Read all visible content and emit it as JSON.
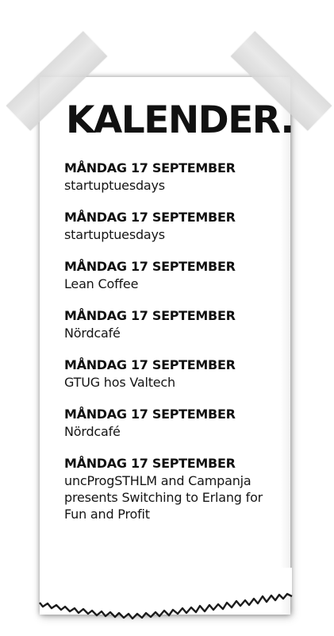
{
  "calendar": {
    "title": "KALENDER.",
    "events": [
      {
        "date": "MÅNDAG 17 SEPTEMBER",
        "name": "startuptuesdays"
      },
      {
        "date": "MÅNDAG 17 SEPTEMBER",
        "name": "startuptuesdays"
      },
      {
        "date": "MÅNDAG 17 SEPTEMBER",
        "name": "Lean Coffee"
      },
      {
        "date": "MÅNDAG 17 SEPTEMBER",
        "name": "Nördcafé"
      },
      {
        "date": "MÅNDAG 17 SEPTEMBER",
        "name": "GTUG hos Valtech"
      },
      {
        "date": "MÅNDAG 17 SEPTEMBER",
        "name": "Nördcafé"
      },
      {
        "date": "MÅNDAG 17 SEPTEMBER",
        "name": "uncProgSTHLM and Campanja presents Switching to Erlang for Fun and Profit"
      }
    ]
  }
}
